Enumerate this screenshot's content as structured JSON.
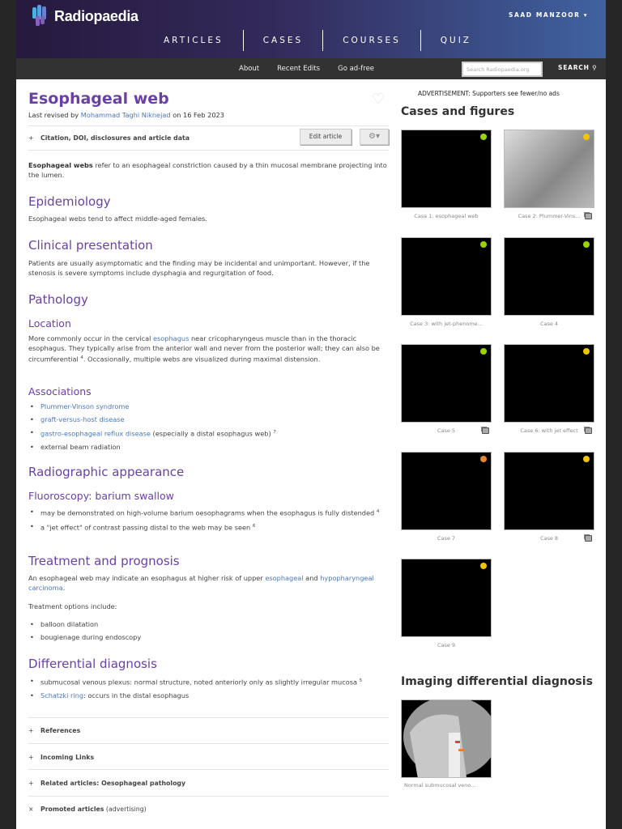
{
  "header": {
    "brand": "Radiopaedia",
    "user": "SAAD MANZOOR",
    "nav": [
      "ARTICLES",
      "CASES",
      "COURSES",
      "QUIZ"
    ]
  },
  "subnav": {
    "links": [
      "About",
      "Recent Edits",
      "Go ad-free"
    ],
    "search_placeholder": "Search Radiopaedia.org",
    "search_label": "SEARCH"
  },
  "article": {
    "title": "Esophageal web",
    "revised_prefix": "Last revised by ",
    "revised_author": "Mohammad Taghi Niknejad",
    "revised_suffix": " on 16 Feb 2023",
    "citation": "Citation, DOI, disclosures and article data",
    "edit_button": "Edit article",
    "intro_bold": "Esophageal webs",
    "intro_rest": " refer to an esophageal constriction caused by a thin mucosal membrane projecting into the lumen.",
    "epidemiology": {
      "heading": "Epidemiology",
      "text": "Esophageal webs tend to affect middle-aged females."
    },
    "clinical": {
      "heading": "Clinical presentation",
      "text": "Patients are usually asymptomatic and the finding may be incidental and unimportant. However, if the stenosis is severe symptoms include dysphagia and regurgitation of food."
    },
    "pathology": {
      "heading": "Pathology",
      "location_heading": "Location",
      "loc_a": "More commonly occur in the cervical ",
      "loc_link": "esophagus",
      "loc_b": " near cricopharyngeus muscle than in the thoracic esophagus. They typically arise from the anterior wall and never from the posterior wall; they can also be circumferential ",
      "loc_sup": "4",
      "loc_c": ". Occasionally, multiple webs are visualized during maximal distension.",
      "assoc_heading": "Associations",
      "assoc": [
        "Plummer-Vinson syndrome",
        "graft-versus-host disease",
        "gastro-esophageal reflux disease",
        " (especially a distal esophagus web) ",
        "7",
        "external beam radiation"
      ]
    },
    "radiographic": {
      "heading": "Radiographic appearance",
      "sub": "Fluoroscopy: barium swallow",
      "items": [
        "may be demonstrated on high-volume barium oesophagrams when the esophagus is fully distended ",
        "4",
        "a \"jet effect\" of contrast passing distal to the web may be seen ",
        "6"
      ]
    },
    "treatment": {
      "heading": "Treatment and prognosis",
      "a": "An esophageal web may indicate an esophagus at higher risk of upper ",
      "link1": "esophageal",
      "b": " and ",
      "link2": "hypopharyngeal carcinoma",
      "c": ".",
      "options": "Treatment options include:",
      "items": [
        "balloon dilatation",
        "bougienage during endoscopy"
      ]
    },
    "ddx": {
      "heading": "Differential diagnosis",
      "item1": "submucosal venous plexus: normal structure, noted anteriorly only as slightly irregular mucosa ",
      "item1_sup": "5",
      "item2_link": "Schatzki ring",
      "item2_rest": ": occurs in the distal esophagus"
    },
    "collapsibles": [
      {
        "sign": "+",
        "label": "References"
      },
      {
        "sign": "+",
        "label": "Incoming Links"
      },
      {
        "sign": "+",
        "label": "Related articles: Oesophageal pathology"
      },
      {
        "sign": "×",
        "label": "Promoted articles",
        "suffix": " (advertising)"
      }
    ]
  },
  "sidebar": {
    "ad": "ADVERTISEMENT: Supporters see fewer/no ads",
    "cases_heading": "Cases and figures",
    "cases": [
      {
        "caption": "Case 1: esophageal web",
        "dot": "#9ad400",
        "stack": false
      },
      {
        "caption": "Case 2: Plummer-Vins...",
        "dot": "#f2c400",
        "stack": true
      },
      {
        "caption": "Case 3: with jet-phenome...",
        "dot": "#9ad400",
        "stack": false
      },
      {
        "caption": "Case 4",
        "dot": "#9ad400",
        "stack": false
      },
      {
        "caption": "Case 5",
        "dot": "#9ad400",
        "stack": true
      },
      {
        "caption": "Case 6: with jet effect",
        "dot": "#f2c400",
        "stack": true
      },
      {
        "caption": "Case 7",
        "dot": "#e8842a",
        "stack": false
      },
      {
        "caption": "Case 8",
        "dot": "#f2c400",
        "stack": true
      },
      {
        "caption": "Case 9",
        "dot": "#f2c400",
        "stack": false
      }
    ],
    "ddx_heading": "Imaging differential diagnosis",
    "ddx_caption": "Normal submucosal veno..."
  }
}
